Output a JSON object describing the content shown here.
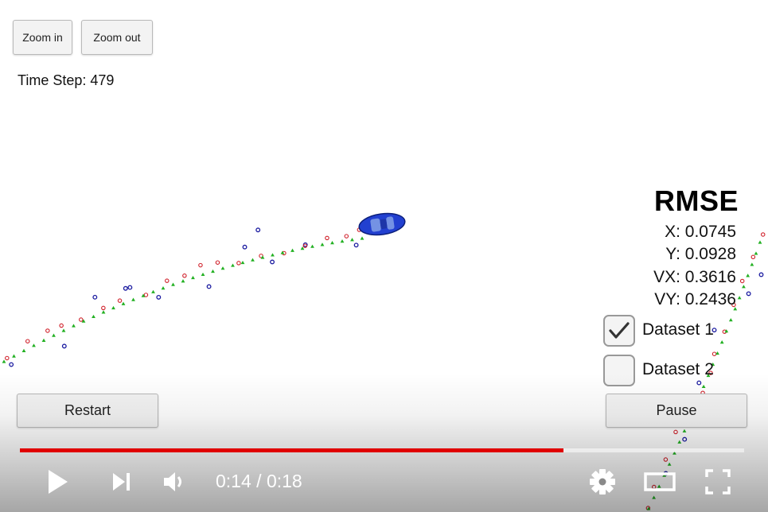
{
  "toolbar": {
    "zoom_in": "Zoom in",
    "zoom_out": "Zoom out"
  },
  "status": {
    "time_step": "Time Step: 479"
  },
  "rmse": {
    "title": "RMSE",
    "x": "X: 0.0745",
    "y": "Y: 0.0928",
    "vx": "VX: 0.3616",
    "vy": "VY: 0.2436"
  },
  "datasets": [
    {
      "label": "Dataset 1",
      "checked": true
    },
    {
      "label": "Dataset 2",
      "checked": false
    }
  ],
  "buttons": {
    "restart": "Restart",
    "pause": "Pause"
  },
  "player": {
    "current_time": "0:14",
    "separator": " / ",
    "duration": "0:18",
    "progress": 0.75,
    "accent_color": "#e00000"
  },
  "legend_colors": {
    "lidar": "#d0202a",
    "radar": "#1a1aa0",
    "estimate": "#22b022",
    "car": "#2240d0"
  },
  "icons": [
    "play-icon",
    "next-icon",
    "volume-icon",
    "settings-icon",
    "theater-mode-icon",
    "fullscreen-icon"
  ]
}
